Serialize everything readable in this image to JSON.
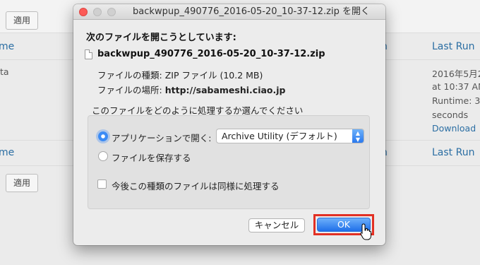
{
  "background": {
    "apply_button_top": "適用",
    "apply_button_bottom": "適用",
    "col_name_top": "me",
    "col_name_bottom": "me",
    "col_last_run_top": "Last Run",
    "col_last_run_bottom": "Last Run",
    "col_n_top": "n",
    "col_n_bottom": "n",
    "row_fragment": "ta",
    "last_run_date": "2016年5月2",
    "last_run_time": "at 10:37 AM",
    "runtime": "Runtime: 3",
    "seconds": "seconds",
    "download_link": "Download"
  },
  "dialog": {
    "title": "backwpup_490776_2016-05-20_10-37-12.zip を開く",
    "heading": "次のファイルを開こうとしています:",
    "filename": "backwpup_490776_2016-05-20_10-37-12.zip",
    "type_label": "ファイルの種類:",
    "type_value": "ZIP ファイル (10.2 MB)",
    "location_label": "ファイルの場所:",
    "location_value": "http://sabameshi.ciao.jp",
    "question": "このファイルをどのように処理するか選んでください",
    "open_with_label": "アプリケーションで開く:",
    "open_with_selected": "Archive Utility (デフォルト)",
    "save_file_label": "ファイルを保存する",
    "remember_label": "今後この種類のファイルは同様に処理する",
    "cancel_label": "キャンセル",
    "ok_label": "OK"
  },
  "colors": {
    "highlight": "#e23024",
    "accent": "#3b8bf5",
    "link": "#2b6ea3"
  }
}
